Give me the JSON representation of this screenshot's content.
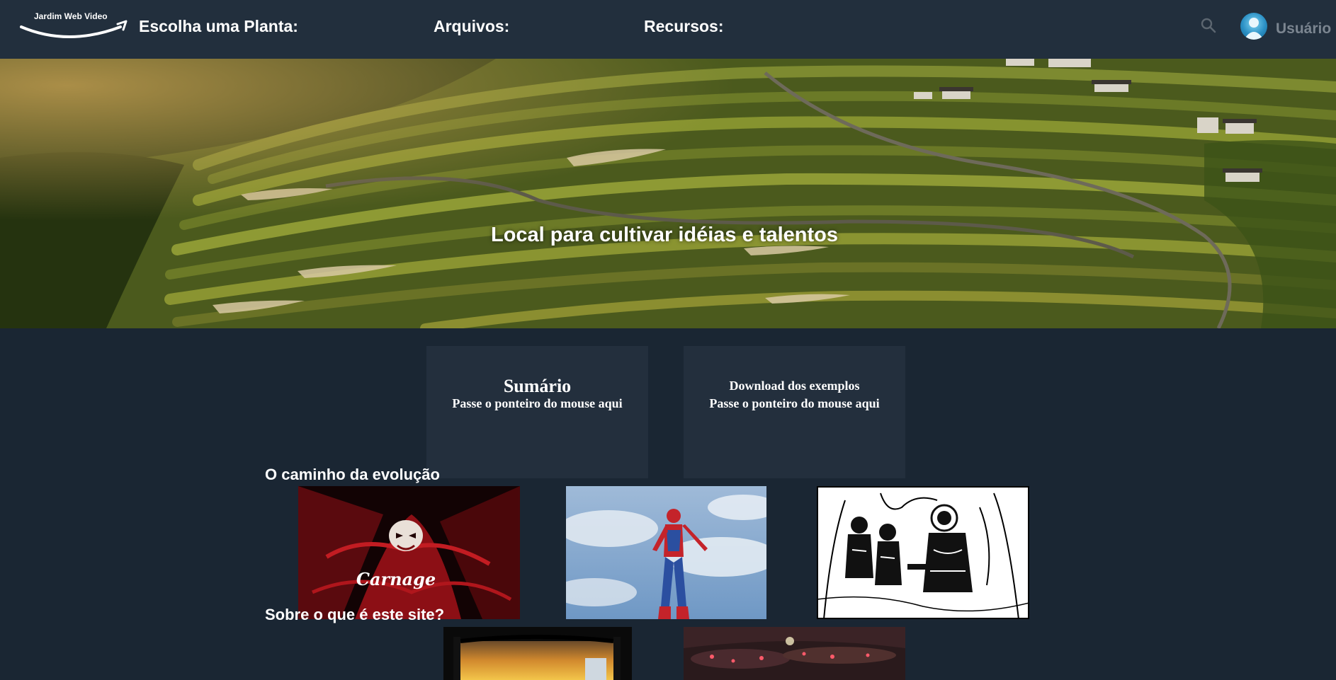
{
  "navbar": {
    "logo_text": "Jardim Web Video",
    "items": [
      {
        "label": "Escolha uma Planta:"
      },
      {
        "label": "Arquivos:"
      },
      {
        "label": "Recursos:"
      }
    ],
    "user_label": "Usuário",
    "icons": {
      "search": "search-icon",
      "avatar": "user-avatar-icon"
    }
  },
  "hero": {
    "title": "Local para cultivar idéias e talentos"
  },
  "cards": [
    {
      "title": "Sumário",
      "subtitle": "Passe o ponteiro do mouse aqui"
    },
    {
      "title": "Download dos exemplos",
      "subtitle": "Passe o ponteiro do mouse aqui"
    }
  ],
  "sections": [
    {
      "heading": "O caminho da evolução",
      "thumbnails": [
        "carnage-image",
        "spiderman-image",
        "comic-astronauts-image"
      ]
    },
    {
      "heading": "Sobre o que é este site?",
      "thumbnails": [
        "sunset-window-image",
        "spaceship-image"
      ]
    }
  ],
  "thumb_text": {
    "carnage_caption": "Carnage"
  },
  "colors": {
    "page_background": "#1a2633",
    "navbar_background": "#222f3d",
    "card_background": "#232f3d",
    "user_label": "#7b8590"
  }
}
